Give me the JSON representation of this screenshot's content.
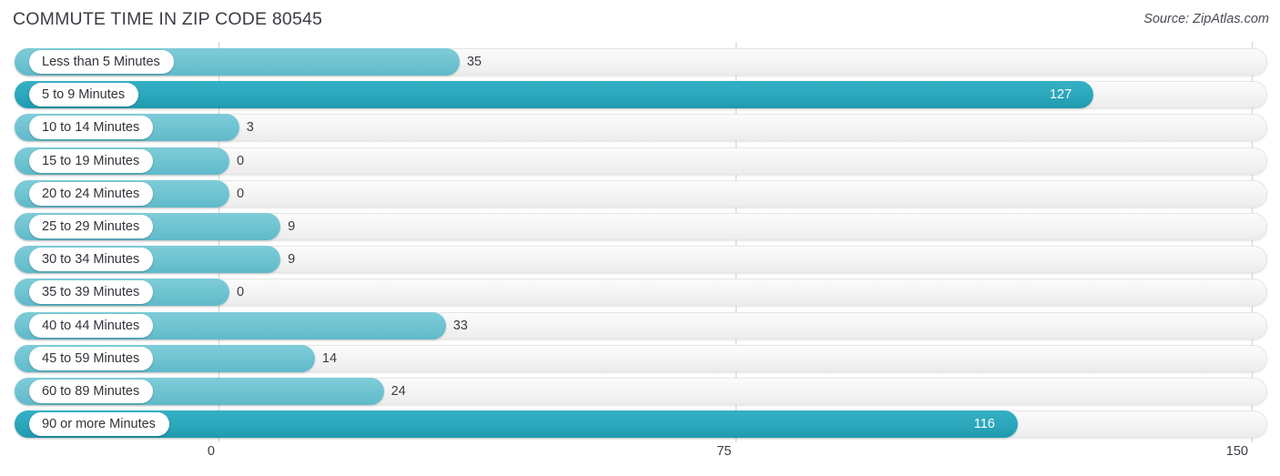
{
  "header": {
    "title": "COMMUTE TIME IN ZIP CODE 80545",
    "source": "Source: ZipAtlas.com"
  },
  "colors": {
    "bar_light": "#6ec3d1",
    "bar_dark": "#2ba6bb",
    "track": "#f4f4f4",
    "gridline": "#d2d2d4",
    "text": "#3b3b44"
  },
  "chart_data": {
    "type": "bar",
    "orientation": "horizontal",
    "title": "COMMUTE TIME IN ZIP CODE 80545",
    "subtitle": "Source: ZipAtlas.com",
    "xlabel": "",
    "ylabel": "",
    "xlim": [
      0,
      150
    ],
    "grid": true,
    "legend": "none",
    "xticks": [
      "0",
      "75",
      "150"
    ],
    "xtick_values": [
      0,
      75,
      150
    ],
    "categories": [
      "Less than 5 Minutes",
      "5 to 9 Minutes",
      "10 to 14 Minutes",
      "15 to 19 Minutes",
      "20 to 24 Minutes",
      "25 to 29 Minutes",
      "30 to 34 Minutes",
      "35 to 39 Minutes",
      "40 to 44 Minutes",
      "45 to 59 Minutes",
      "60 to 89 Minutes",
      "90 or more Minutes"
    ],
    "values": [
      35,
      127,
      3,
      0,
      0,
      9,
      9,
      0,
      33,
      14,
      24,
      116
    ],
    "value_labels": [
      "35",
      "127",
      "3",
      "0",
      "0",
      "9",
      "9",
      "0",
      "33",
      "14",
      "24",
      "116"
    ],
    "bars": [
      {
        "label": "Less than 5 Minutes",
        "value": 35,
        "value_label": "35",
        "highlight": false
      },
      {
        "label": "5 to 9 Minutes",
        "value": 127,
        "value_label": "127",
        "highlight": true
      },
      {
        "label": "10 to 14 Minutes",
        "value": 3,
        "value_label": "3",
        "highlight": false
      },
      {
        "label": "15 to 19 Minutes",
        "value": 0,
        "value_label": "0",
        "highlight": false
      },
      {
        "label": "20 to 24 Minutes",
        "value": 0,
        "value_label": "0",
        "highlight": false
      },
      {
        "label": "25 to 29 Minutes",
        "value": 9,
        "value_label": "9",
        "highlight": false
      },
      {
        "label": "30 to 34 Minutes",
        "value": 9,
        "value_label": "9",
        "highlight": false
      },
      {
        "label": "35 to 39 Minutes",
        "value": 0,
        "value_label": "0",
        "highlight": false
      },
      {
        "label": "40 to 44 Minutes",
        "value": 33,
        "value_label": "33",
        "highlight": false
      },
      {
        "label": "45 to 59 Minutes",
        "value": 14,
        "value_label": "14",
        "highlight": false
      },
      {
        "label": "60 to 89 Minutes",
        "value": 24,
        "value_label": "24",
        "highlight": false
      },
      {
        "label": "90 or more Minutes",
        "value": 116,
        "value_label": "116",
        "highlight": true
      }
    ]
  }
}
